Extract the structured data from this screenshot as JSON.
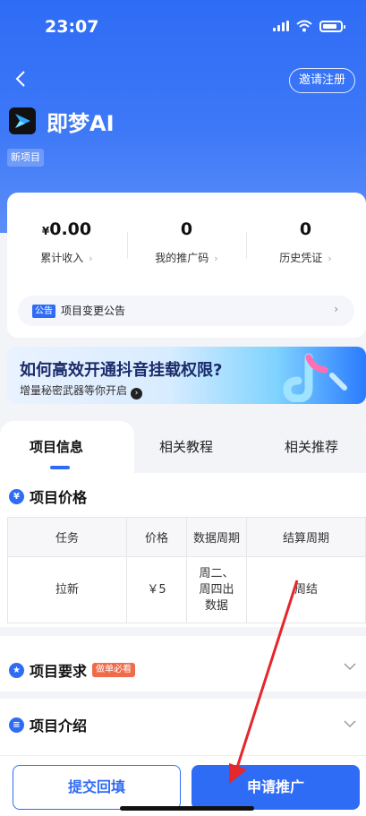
{
  "status_bar": {
    "time": "23:07"
  },
  "header": {
    "invite_label": "邀请注册",
    "app_name": "即梦AI",
    "tag": "新项目"
  },
  "stats": [
    {
      "currency": "¥",
      "value": "0.00",
      "label": "累计收入"
    },
    {
      "currency": "",
      "value": "0",
      "label": "我的推广码"
    },
    {
      "currency": "",
      "value": "0",
      "label": "历史凭证"
    }
  ],
  "notice": {
    "badge": "公告",
    "text": "项目变更公告"
  },
  "banner": {
    "title": "如何高效开通抖音挂载权限?",
    "subtitle": "增量秘密武器等你开启"
  },
  "tabs": [
    {
      "label": "项目信息",
      "active": true
    },
    {
      "label": "相关教程",
      "active": false
    },
    {
      "label": "相关推荐",
      "active": false
    }
  ],
  "sections": {
    "price": {
      "title": "项目价格",
      "icon": "yen-icon"
    },
    "requirements": {
      "title": "项目要求",
      "badge": "做单必看",
      "icon": "star-icon"
    },
    "intro": {
      "title": "项目介绍",
      "icon": "doc-icon"
    }
  },
  "price_table": {
    "headers": [
      "任务",
      "价格",
      "数据周期",
      "结算周期"
    ],
    "rows": [
      {
        "task": "拉新",
        "price": "￥5",
        "data_cycle_1": "周二、",
        "data_cycle_2": "周四出",
        "data_cycle_3": "数据",
        "settle_cycle": "周结"
      }
    ]
  },
  "buttons": {
    "submit": "提交回填",
    "apply": "申请推广"
  },
  "colors": {
    "primary": "#2f6cf6",
    "price_red": "#e53935",
    "must_badge": "#ef6b4a",
    "arrow_red": "#e5262b"
  }
}
